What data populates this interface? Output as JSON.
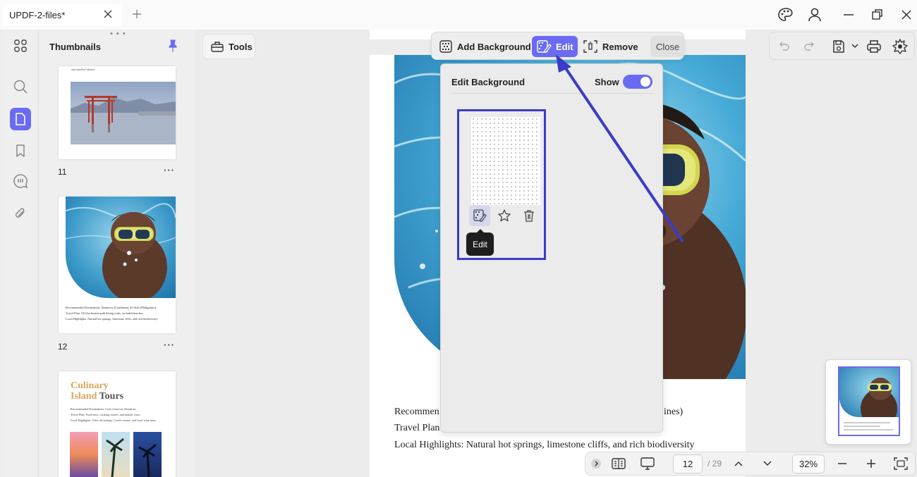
{
  "titlebar": {
    "tab_title": "UPDF-2-files*",
    "icons": [
      "close-icon",
      "plus-icon",
      "palette-icon",
      "user-icon",
      "minimize-icon",
      "restore-icon",
      "close-window-icon"
    ]
  },
  "left_rail": {
    "items": [
      {
        "name": "thumbnails",
        "icon": "grid-icon",
        "selected": false
      },
      {
        "name": "search",
        "icon": "search-icon",
        "selected": false
      },
      {
        "name": "pages",
        "icon": "page-icon",
        "selected": true
      },
      {
        "name": "bookmarks",
        "icon": "bookmark-icon",
        "selected": false
      },
      {
        "name": "comments",
        "icon": "comment-icon",
        "selected": false
      },
      {
        "name": "attachments",
        "icon": "paperclip-icon",
        "selected": false
      }
    ],
    "accent_color": "#6a6bf2"
  },
  "thumbnails_panel": {
    "title": "Thumbnails",
    "more": "...",
    "pages": [
      {
        "number": "11",
        "caption": "and mischief balance"
      },
      {
        "number": "12",
        "text_lines": [
          "Recommended Destinations: Dominica (Caribbean), El Nido (Philippines)",
          "Travel Plan: Off-the-beaten-path hiking trails, secluded beaches",
          "Local Highlights: Natural hot springs, limestone cliffs, and rich biodiversity"
        ]
      },
      {
        "number": "13",
        "heading_line1": "Culinary",
        "heading_line2_a": "Island",
        "heading_line2_b": "Tours",
        "text_lines": [
          "Recommended Destinations: Crete (Greece), Mauritius",
          "Travel Plan: Food tours, cooking classes, and market visits",
          "Local Highlights: Olive oil tastings, Creole cuisine, and local wine tours"
        ]
      }
    ],
    "dots": "···"
  },
  "tools_button": {
    "label": "Tools"
  },
  "bg_toolbar": {
    "add_background": "Add Background",
    "edit": "Edit",
    "remove": "Remove",
    "close": "Close"
  },
  "edit_background_popup": {
    "title": "Edit Background",
    "show_label": "Show",
    "show_enabled": true,
    "tooltip": "Edit",
    "card_actions": [
      "edit-icon",
      "star-icon",
      "trash-icon"
    ]
  },
  "document": {
    "lines": [
      {
        "a": "Recommen",
        "b": "ines)"
      },
      {
        "a": "Travel Plan",
        "b": ""
      },
      {
        "a": "Local Highlights: Natural hot springs, limestone cliffs, and rich biodiversity",
        "b": ""
      }
    ]
  },
  "right_toolbar": {
    "icons": [
      "undo-icon",
      "redo-icon",
      "save-icon",
      "chevron-down-icon",
      "print-icon",
      "ai-assistant-icon"
    ]
  },
  "bottom_bar": {
    "current_page": "12",
    "total_pages": "/ 29",
    "zoom": "32%"
  },
  "highlight_color": "#3b3bc9"
}
